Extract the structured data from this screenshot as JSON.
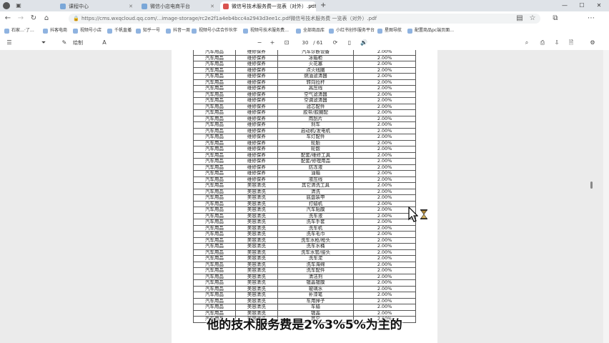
{
  "browser": {
    "tabs": [
      {
        "label": "课程中心"
      },
      {
        "label": "微信小店电商平台"
      },
      {
        "label": "微信号技术服务费一览表（对外）.pdf",
        "active": true
      }
    ],
    "url": "https://cms.wxqcloud.qq.com/...image-storage/rc2e2f1a4eb4bcc4a2943d3ee1c.pdf微信号技术服务费 一览表（对外）.pdf",
    "bookmarks": [
      "石家…·了…",
      "抖客电商",
      "视频号小店",
      "千帆直播",
      "知乎一号",
      "抖音一周",
      "视频号小店合作伙伴",
      "视频号技术服务费…",
      "全部商品库",
      "小红书创作服务平台",
      "星图导航",
      "配置商品pc端页面…"
    ],
    "pdf_toolbar": {
      "draw_label": "绘制",
      "page_current": "30",
      "page_total": "/ 61"
    }
  },
  "table": {
    "rows": [
      [
        "汽车用品",
        "维修保养",
        "汽车诊断设备",
        "2.00%"
      ],
      [
        "汽车用品",
        "维修保养",
        "冰箱柜",
        "2.00%"
      ],
      [
        "汽车用品",
        "维修保养",
        "火花塞",
        "2.00%"
      ],
      [
        "汽车用品",
        "维修保养",
        "点火线圈",
        "2.00%"
      ],
      [
        "汽车用品",
        "维修保养",
        "燃油滤清器",
        "2.00%"
      ],
      [
        "汽车用品",
        "维修保养",
        "转向拉杆",
        "2.00%"
      ],
      [
        "汽车用品",
        "维修保养",
        "高压线",
        "2.00%"
      ],
      [
        "汽车用品",
        "维修保养",
        "空气滤清器",
        "2.00%"
      ],
      [
        "汽车用品",
        "维修保养",
        "空调滤清器",
        "2.00%"
      ],
      [
        "汽车用品",
        "维修保养",
        "滤芯配件",
        "2.00%"
      ],
      [
        "汽车用品",
        "维修保养",
        "胶带/胶圈配",
        "2.00%"
      ],
      [
        "汽车用品",
        "维修保养",
        "雨刮片",
        "2.00%"
      ],
      [
        "汽车用品",
        "维修保养",
        "刹车",
        "2.00%"
      ],
      [
        "汽车用品",
        "维修保养",
        "启动机/发电机",
        "2.00%"
      ],
      [
        "汽车用品",
        "维修保养",
        "车灯配件",
        "2.00%"
      ],
      [
        "汽车用品",
        "维修保养",
        "轮胎",
        "2.00%"
      ],
      [
        "汽车用品",
        "维修保养",
        "轮毂",
        "2.00%"
      ],
      [
        "汽车用品",
        "维修保养",
        "配套/维修工具",
        "2.00%"
      ],
      [
        "汽车用品",
        "维修保养",
        "配套/修理用品",
        "2.00%"
      ],
      [
        "汽车用品",
        "维修保养",
        "防冻液",
        "2.00%"
      ],
      [
        "汽车用品",
        "维修保养",
        "油箱",
        "2.00%"
      ],
      [
        "汽车用品",
        "维修保养",
        "液压线",
        "2.00%"
      ],
      [
        "汽车用品",
        "美容清洗",
        "其它清洗工具",
        "2.00%"
      ],
      [
        "汽车用品",
        "美容清洗",
        "清洗",
        "2.00%"
      ],
      [
        "汽车用品",
        "美容清洗",
        "底盘装甲",
        "2.00%"
      ],
      [
        "汽车用品",
        "美容清洗",
        "打蜡机",
        "2.00%"
      ],
      [
        "汽车用品",
        "美容清洗",
        "汽车贴膜",
        "2.00%"
      ],
      [
        "汽车用品",
        "美容清洗",
        "洗车液",
        "2.00%"
      ],
      [
        "汽车用品",
        "美容清洗",
        "洗车手套",
        "2.00%"
      ],
      [
        "汽车用品",
        "美容清洗",
        "洗车机",
        "2.00%"
      ],
      [
        "汽车用品",
        "美容清洗",
        "洗车毛巾",
        "2.00%"
      ],
      [
        "汽车用品",
        "美容清洗",
        "洗车水枪/枪头",
        "2.00%"
      ],
      [
        "汽车用品",
        "美容清洗",
        "洗车水桶",
        "2.00%"
      ],
      [
        "汽车用品",
        "美容清洗",
        "洗车水管/接头",
        "2.00%"
      ],
      [
        "汽车用品",
        "美容清洗",
        "洗车泥",
        "2.00%"
      ],
      [
        "汽车用品",
        "美容清洗",
        "洗车海绵",
        "2.00%"
      ],
      [
        "汽车用品",
        "美容清洗",
        "洗车配件",
        "2.00%"
      ],
      [
        "汽车用品",
        "美容清洗",
        "清洁剂",
        "2.00%"
      ],
      [
        "汽车用品",
        "美容清洗",
        "镀晶镀膜",
        "2.00%"
      ],
      [
        "汽车用品",
        "美容清洗",
        "玻璃水",
        "2.00%"
      ],
      [
        "汽车用品",
        "美容清洗",
        "补漆笔",
        "2.00%"
      ],
      [
        "汽车用品",
        "美容清洗",
        "车用掸子",
        "2.00%"
      ],
      [
        "汽车用品",
        "美容清洗",
        "车蜡",
        "2.00%"
      ],
      [
        "汽车用品",
        "美容清洗",
        "镀晶",
        "2.00%"
      ],
      [
        "汽车用品",
        "美容清洗",
        "其它",
        "2.00%"
      ]
    ]
  },
  "subtitle": "他的技术服务费是2%3%5%为主的"
}
